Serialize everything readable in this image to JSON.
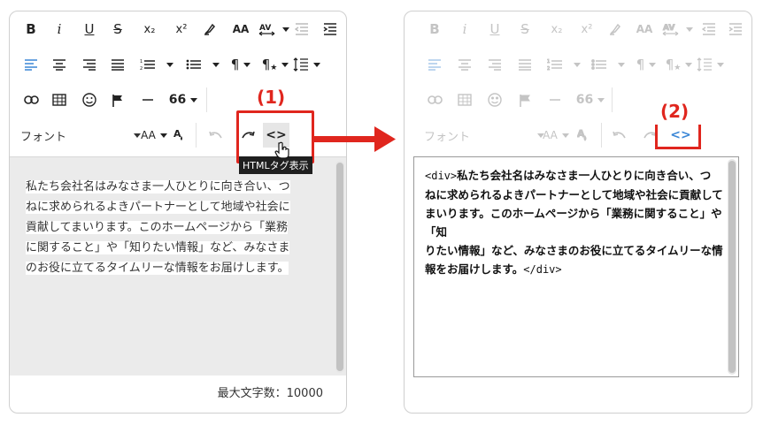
{
  "left": {
    "font_label": "フォント",
    "size_label": "AA",
    "tooltip": "HTMLタグ表示",
    "callout": "(1)",
    "text": [
      "私たち会社名はみなさま一人ひとりに向き合い、つ",
      "ねに求められるよきパートナーとして地域や社会に",
      "貢献してまいります。このホームページから「業務",
      "に関すること」や「知りたい情報」など、みなさま",
      "のお役に立てるタイムリーな情報をお届けします。"
    ],
    "char_count": "最大文字数：10000"
  },
  "right": {
    "font_label": "フォント",
    "size_label": "AA",
    "callout": "(2)",
    "code_open": "<div>",
    "code_lines": [
      "私たち会社名はみなさま一人ひとりに向き合い、つ",
      "ねに求められるよきパートナーとして地域や社会に貢献して",
      "まいります。このホームページから「業務に関すること」や「知",
      "りたい情報」など、みなさまのお役に立てるタイムリーな情",
      "報をお届けします。"
    ],
    "code_close": "</div>"
  },
  "toolbar": {
    "bold": "B",
    "italic": "i",
    "underline": "U",
    "strike": "S",
    "sub": "x₂",
    "sup": "x²",
    "paragraph": "¶",
    "quote": "66",
    "code": "<>"
  },
  "colors": {
    "accent": "#3a86d6",
    "callout": "#e0261e",
    "editor_bg": "#ebebeb"
  }
}
